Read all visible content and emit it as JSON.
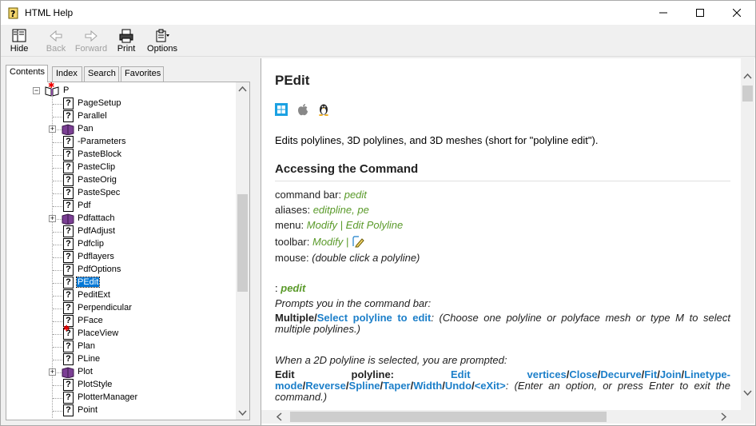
{
  "window": {
    "title": "HTML Help"
  },
  "toolbar": {
    "hide": "Hide",
    "back": "Back",
    "forward": "Forward",
    "print": "Print",
    "options": "Options"
  },
  "tabs": [
    "Contents",
    "Index",
    "Search",
    "Favorites"
  ],
  "tree": {
    "root": "P",
    "items": [
      {
        "label": "PageSetup",
        "type": "topic"
      },
      {
        "label": "Parallel",
        "type": "topic"
      },
      {
        "label": "Pan",
        "type": "book"
      },
      {
        "label": "-Parameters",
        "type": "topic"
      },
      {
        "label": "PasteBlock",
        "type": "topic"
      },
      {
        "label": "PasteClip",
        "type": "topic"
      },
      {
        "label": "PasteOrig",
        "type": "topic"
      },
      {
        "label": "PasteSpec",
        "type": "topic"
      },
      {
        "label": "Pdf",
        "type": "topic"
      },
      {
        "label": "Pdfattach",
        "type": "book"
      },
      {
        "label": "PdfAdjust",
        "type": "topic"
      },
      {
        "label": "Pdfclip",
        "type": "topic"
      },
      {
        "label": "Pdflayers",
        "type": "topic"
      },
      {
        "label": "PdfOptions",
        "type": "topic"
      },
      {
        "label": "PEdit",
        "type": "topic",
        "selected": true
      },
      {
        "label": "PeditExt",
        "type": "topic"
      },
      {
        "label": "Perpendicular",
        "type": "topic"
      },
      {
        "label": "PFace",
        "type": "topic"
      },
      {
        "label": "PlaceView",
        "type": "topic",
        "star": true
      },
      {
        "label": "Plan",
        "type": "topic"
      },
      {
        "label": "PLine",
        "type": "topic"
      },
      {
        "label": "Plot",
        "type": "book"
      },
      {
        "label": "PlotStyle",
        "type": "topic"
      },
      {
        "label": "PlotterManager",
        "type": "topic"
      },
      {
        "label": "Point",
        "type": "topic"
      }
    ]
  },
  "doc": {
    "title": "PEdit",
    "description": "Edits polylines, 3D polylines, and 3D meshes (short for \"polyline edit\").",
    "section": "Accessing the Command",
    "command_bar_key": "command bar:",
    "command_bar_val": "pedit",
    "aliases_key": "aliases:",
    "aliases_val": "editpline, pe",
    "menu_key": "menu:",
    "menu_val": "Modify | Edit Polyline",
    "toolbar_key": "toolbar:",
    "toolbar_val": "Modify |",
    "mouse_key": "mouse:",
    "mouse_val": "(double click a polyline)",
    "prompt_colon": ":",
    "prompt_cmd": "pedit",
    "prompts_line": "Prompts you in the command bar:",
    "multiple_bold": "Multiple",
    "slash1": "/",
    "select_link": "Select polyline to edit",
    "multiple_rest": ": (Choose one polyline or polyface mesh or type M to select multiple polylines.)",
    "when2d": "When a 2D polyline is selected, you are prompted:",
    "edit_polyline": "Edit polyline:",
    "opts": [
      "Edit vertices",
      "Close",
      "Decurve",
      "Fit",
      "Join",
      "Linetype-mode",
      "Reverse",
      "Spline",
      "Taper",
      "Width",
      "Undo",
      "<eXit>"
    ],
    "edit_rest": ": (Enter an option, or press Enter to exit the command.)"
  }
}
